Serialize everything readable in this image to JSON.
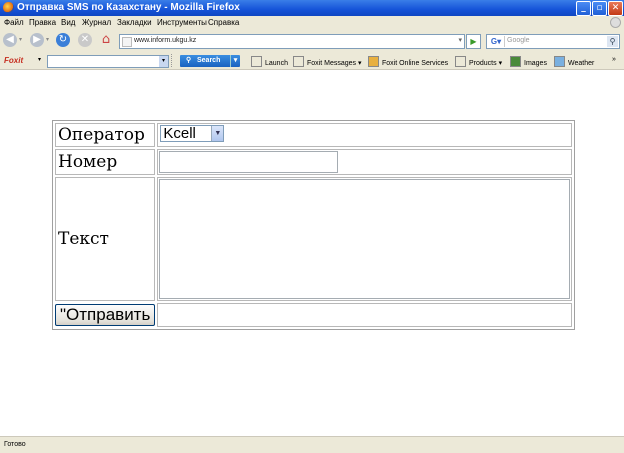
{
  "window": {
    "title": "Отправка SMS по Казахстану - Mozilla Firefox"
  },
  "menu": [
    "Файл",
    "Правка",
    "Вид",
    "Журнал",
    "Закладки",
    "Инструменты",
    "Справка"
  ],
  "nav": {
    "url": "www.inform.ukgu.kz",
    "search_placeholder": "Google"
  },
  "foxit_toolbar": {
    "logo": "Foxit",
    "search_label": "Search",
    "items": [
      "Launch",
      "Foxit Messages",
      "Foxit Online Services",
      "Products",
      "Images",
      "Weather"
    ],
    "overflow": "»"
  },
  "form": {
    "operator_label": "Оператор",
    "operator_value": "Kcell",
    "number_label": "Номер",
    "number_value": "",
    "text_label": "Текст",
    "text_value": "",
    "submit_label": "\"Отправить"
  },
  "status": {
    "text": "Готово"
  }
}
